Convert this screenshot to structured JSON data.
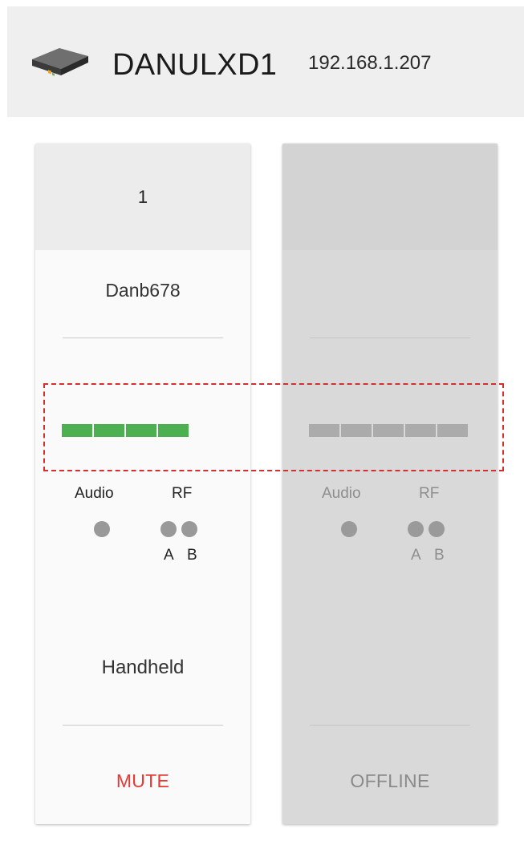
{
  "header": {
    "device_icon": "receiver-device-icon",
    "device_name": "DANULXD1",
    "ip_address": "192.168.1.207"
  },
  "channels": [
    {
      "number": "1",
      "name": "Danb678",
      "meter_segments": 4,
      "meter_color": "#4caf50",
      "audio_label": "Audio",
      "rf_label": "RF",
      "antenna_a": "A",
      "antenna_b": "B",
      "type": "Handheld",
      "status": "MUTE",
      "status_color": "#e53935"
    },
    {
      "number": "",
      "name": "",
      "meter_segments": 5,
      "meter_color": "#ababab",
      "audio_label": "Audio",
      "rf_label": "RF",
      "antenna_a": "A",
      "antenna_b": "B",
      "type": "",
      "status": "OFFLINE",
      "status_color": "#8a8a8a"
    }
  ],
  "highlight_color": "#d32f2f"
}
